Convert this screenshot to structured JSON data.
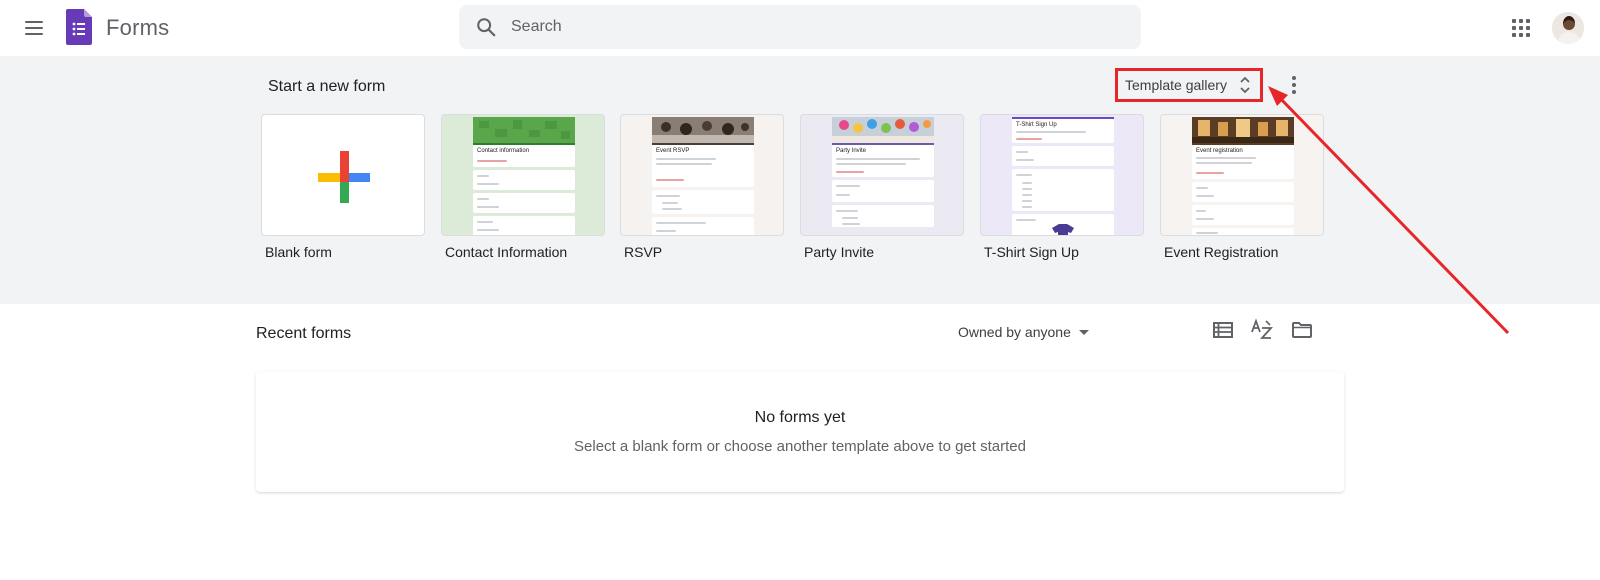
{
  "header": {
    "app_title": "Forms",
    "search_placeholder": "Search"
  },
  "templates": {
    "section_title": "Start a new form",
    "gallery_label": "Template gallery",
    "items": [
      {
        "label": "Blank form"
      },
      {
        "label": "Contact Information",
        "thumb_title": "Contact information"
      },
      {
        "label": "RSVP",
        "thumb_title": "Event RSVP"
      },
      {
        "label": "Party Invite",
        "thumb_title": "Party Invite"
      },
      {
        "label": "T-Shirt Sign Up",
        "thumb_title": "T-Shirt Sign Up"
      },
      {
        "label": "Event Registration",
        "thumb_title": "Event registration"
      }
    ]
  },
  "recent": {
    "title": "Recent forms",
    "owner_filter": "Owned by anyone",
    "empty_title": "No forms yet",
    "empty_subtitle": "Select a blank form or choose another template above to get started"
  },
  "colors": {
    "forms_purple": "#673ab7",
    "band_background": "#f1f3f4",
    "annotation_red": "#e8262a"
  },
  "icons": [
    "menu-icon",
    "forms-logo-icon",
    "search-icon",
    "apps-grid-icon",
    "chevron-updown-icon",
    "more-vert-icon",
    "list-view-icon",
    "sort-az-icon",
    "folder-icon"
  ]
}
